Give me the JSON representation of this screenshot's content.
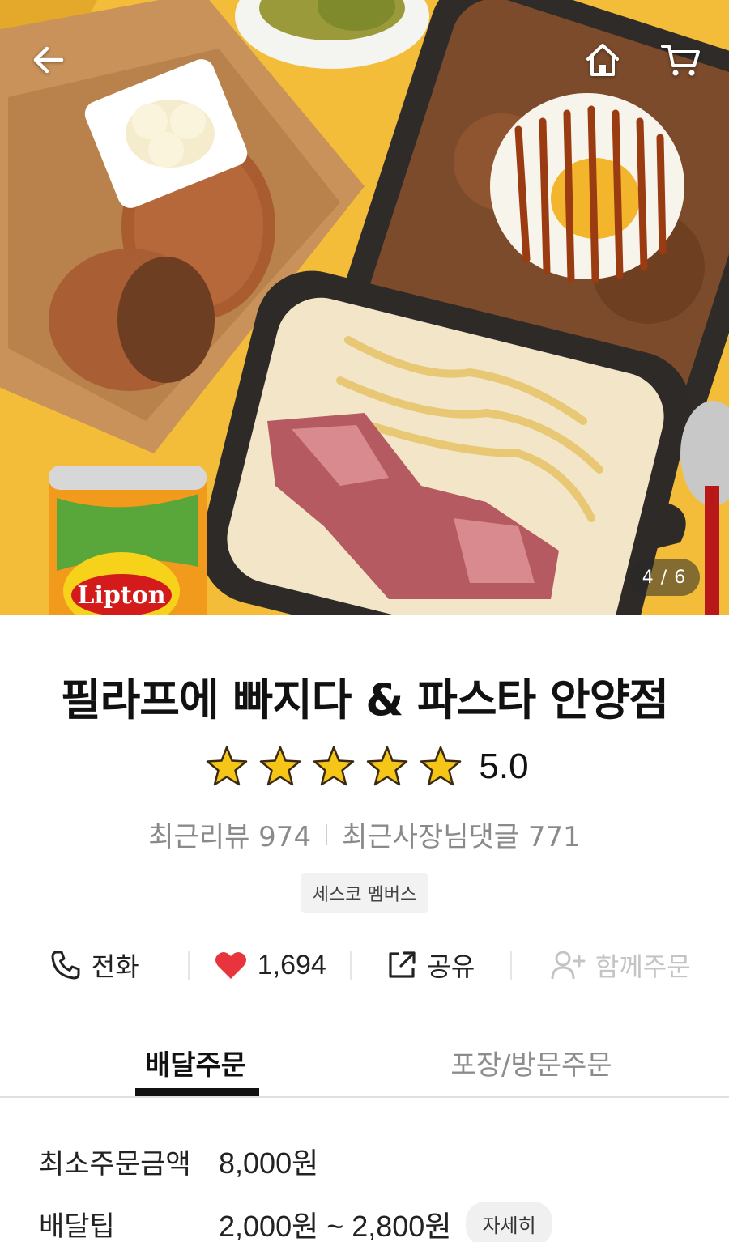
{
  "header": {
    "back_icon": "arrow-left-icon",
    "home_icon": "home-icon",
    "cart_icon": "cart-icon",
    "image_counter": "4 / 6",
    "can_label": "Lipton"
  },
  "store": {
    "name": "필라프에 빠지다 & 파스타 안양점",
    "rating": "5.0",
    "rating_stars": 5,
    "recent_reviews": "최근리뷰 974",
    "owner_replies": "최근사장님댓글 771",
    "badge": "세스코 멤버스"
  },
  "actions": {
    "call": {
      "icon": "phone-icon",
      "label": "전화"
    },
    "like": {
      "icon": "heart-icon",
      "label": "1,694"
    },
    "share": {
      "icon": "share-icon",
      "label": "공유"
    },
    "group": {
      "icon": "add-person-icon",
      "label": "함께주문"
    }
  },
  "tabs": {
    "delivery": "배달주문",
    "pickup": "포장/방문주문"
  },
  "info": {
    "min_order_label": "최소주문금액",
    "min_order_value": "8,000원",
    "delivery_tip_label": "배달팁",
    "delivery_tip_value": "2,000원 ~ 2,800원",
    "detail_button": "자세히"
  },
  "colors": {
    "heart": "#e8343c",
    "star": "#f5c518",
    "hero_background": "#f2bd3c",
    "tab_indicator": "#111111"
  }
}
